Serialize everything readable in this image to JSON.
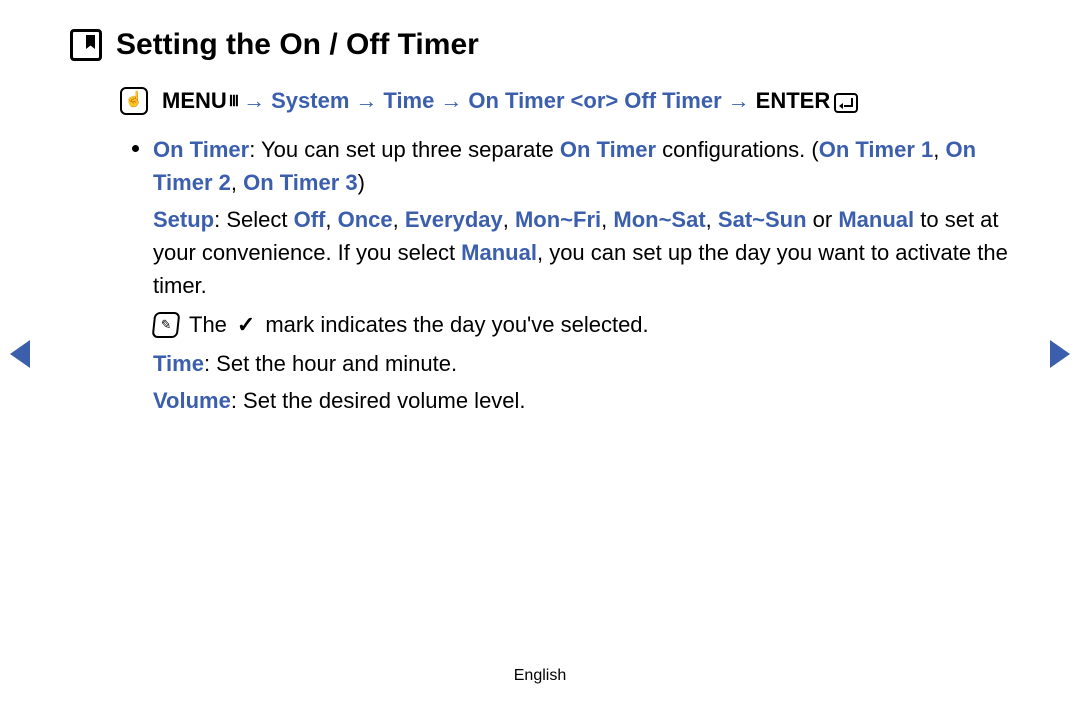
{
  "title": "Setting the On / Off Timer",
  "nav": {
    "menu_label": "MENU",
    "arrow": "→",
    "p1": "System",
    "p2": "Time",
    "p3": "On Timer",
    "or_literal": "<or>",
    "p4": "Off Timer",
    "enter_label": "ENTER"
  },
  "body": {
    "b1": {
      "lead": "On Timer",
      "txt1": ": You can set up three separate ",
      "highlight1": "On Timer",
      "txt2": " configurations. (",
      "cfg1": "On Timer 1",
      "sep": ", ",
      "cfg2": "On Timer 2",
      "cfg3": "On Timer 3",
      "close": ")"
    },
    "setup": {
      "lead": "Setup",
      "txt1": ": Select ",
      "o1": "Off",
      "o2": "Once",
      "o3": "Everyday",
      "o4": "Mon~Fri",
      "o5": "Mon~Sat",
      "o6": "Sat~Sun",
      "or_word": " or ",
      "o7": "Manual",
      "txt2": " to set at your convenience. If you select ",
      "o7b": "Manual",
      "txt3": ", you can set up the day you want to activate the timer."
    },
    "note": {
      "pre": "The ",
      "post": " mark indicates the day you've selected."
    },
    "time": {
      "lead": "Time",
      "txt": ": Set the hour and minute."
    },
    "volume": {
      "lead": "Volume",
      "txt": ": Set the desired volume level."
    }
  },
  "footer": "English"
}
